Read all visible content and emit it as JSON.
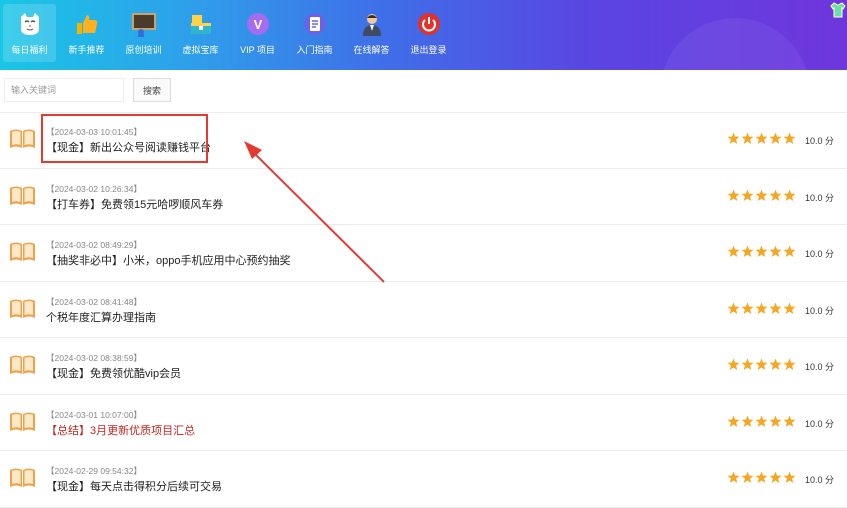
{
  "nav": {
    "items": [
      {
        "label": "每日福利",
        "icon": "cat-face-icon",
        "active": true
      },
      {
        "label": "新手推荐",
        "icon": "thumbs-up-icon"
      },
      {
        "label": "原创培训",
        "icon": "blackboard-icon"
      },
      {
        "label": "虚拟宝库",
        "icon": "treasure-box-icon"
      },
      {
        "label": "VIP 项目",
        "icon": "vip-icon"
      },
      {
        "label": "入门指南",
        "icon": "guide-book-icon"
      },
      {
        "label": "在线解答",
        "icon": "support-person-icon"
      },
      {
        "label": "退出登录",
        "icon": "power-icon"
      }
    ],
    "corner_icon": "tshirt-icon"
  },
  "search": {
    "placeholder": "输入关键词",
    "value": "",
    "button_label": "搜索"
  },
  "list": {
    "items": [
      {
        "timestamp": "【2024-03-03 10:01:45】",
        "title": "【现金】新出公众号阅读赚钱平台",
        "title_color": "#222222",
        "rating": 5,
        "score": "10.0 分"
      },
      {
        "timestamp": "【2024-03-02 10:26:34】",
        "title": "【打车券】免费领15元哈啰顺风车券",
        "title_color": "#222222",
        "rating": 5,
        "score": "10.0 分"
      },
      {
        "timestamp": "【2024-03-02 08:49:29】",
        "title": "【抽奖非必中】小米，oppo手机应用中心预约抽奖",
        "title_color": "#222222",
        "rating": 5,
        "score": "10.0 分"
      },
      {
        "timestamp": "【2024-03-02 08:41:48】",
        "title": "个税年度汇算办理指南",
        "title_color": "#222222",
        "rating": 5,
        "score": "10.0 分"
      },
      {
        "timestamp": "【2024-03-02 08:38:59】",
        "title": "【现金】免费领优酷vip会员",
        "title_color": "#222222",
        "rating": 5,
        "score": "10.0 分"
      },
      {
        "timestamp": "【2024-03-01 10:07:00】",
        "title": "【总结】3月更新优质项目汇总",
        "title_color": "#c0271f",
        "rating": 5,
        "score": "10.0 分"
      },
      {
        "timestamp": "【2024-02-29 09:54:32】",
        "title": "【现金】每天点击得积分后续可交易",
        "title_color": "#222222",
        "rating": 5,
        "score": "10.0 分"
      }
    ],
    "item_icon": "open-book-icon",
    "star_color": "#f5a623"
  },
  "annotation": {
    "highlight_color": "#e53a2f"
  }
}
